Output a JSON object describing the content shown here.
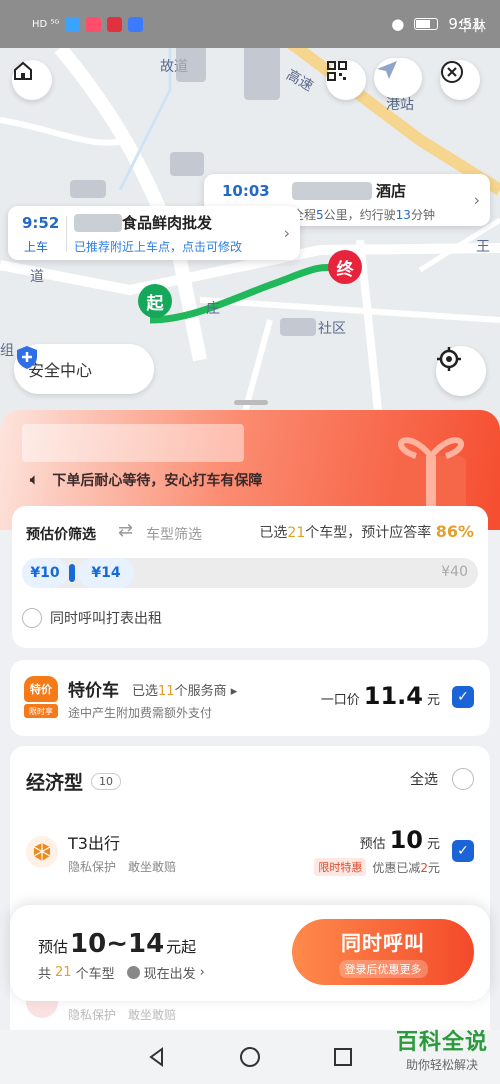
{
  "status_bar": {
    "left_text": "HD ⁵ᴳ",
    "time": "9:51"
  },
  "map": {
    "labels": {
      "road_left": "故道",
      "highway": "高速",
      "station": "港站",
      "top_right": "华林",
      "wang": "王",
      "zhuang": "庄",
      "shequ": "社区",
      "dao": "道",
      "zu": "组"
    },
    "pickup": {
      "time": "9:52",
      "tag": "上车",
      "name": "食品鲜肉批发",
      "hint": "已推荐附近上车点，点击可修改"
    },
    "dropoff": {
      "time": "10:03",
      "name": "酒店",
      "distance_prefix": "全程",
      "distance": "5",
      "distance_unit": "公里，约行驶",
      "duration": "13",
      "duration_unit": "分钟"
    },
    "start_pin": "起",
    "end_pin": "终",
    "safety_label": "安全中心"
  },
  "banner": {
    "notice": "下单后耐心等待，安心打车有保障"
  },
  "filter": {
    "price_filter": "预估价筛选",
    "type_filter": "车型筛选",
    "selected_prefix": "已选",
    "selected_count": "21",
    "selected_suffix": "个车型，预计应答率",
    "answer_rate": "86%",
    "min_price": "¥10",
    "max_price": "¥14",
    "range_max": "¥40",
    "taxi_option": "同时呼叫打表出租"
  },
  "special": {
    "badge_top": "特价",
    "badge_bottom": "限时享",
    "name": "特价车",
    "providers_prefix": "已选",
    "providers_count": "11",
    "providers_suffix": "个服务商",
    "note": "途中产生附加费需额外支付",
    "price_label": "一口价",
    "price": "11.4",
    "unit": "元"
  },
  "economy": {
    "title": "经济型",
    "count": "10",
    "select_all": "全选",
    "t3": {
      "name": "T3出行",
      "sub": "隐私保护　敢坐敢赔",
      "price_label": "预估",
      "price": "10",
      "unit": "元",
      "promo_tag": "限时特惠",
      "discount_prefix": "优惠已减",
      "discount": "2",
      "discount_unit": "元"
    },
    "ghost": "隐私保护　敢坐敢赔"
  },
  "bottom": {
    "est_prefix": "预估",
    "est_range": "10~14",
    "est_suffix": "元起",
    "count_prefix": "共",
    "count": "21",
    "count_suffix": "个车型",
    "depart": "现在出发",
    "call_label": "同时呼叫",
    "call_sub": "登录后优惠更多"
  },
  "watermark": {
    "main": "百科全说",
    "sub": "助你轻松解决"
  },
  "colors": {
    "accent_blue": "#1a64d8",
    "route_green": "#20b85a",
    "call_orange": "#f34a2a",
    "highlight": "#e3a02b"
  }
}
